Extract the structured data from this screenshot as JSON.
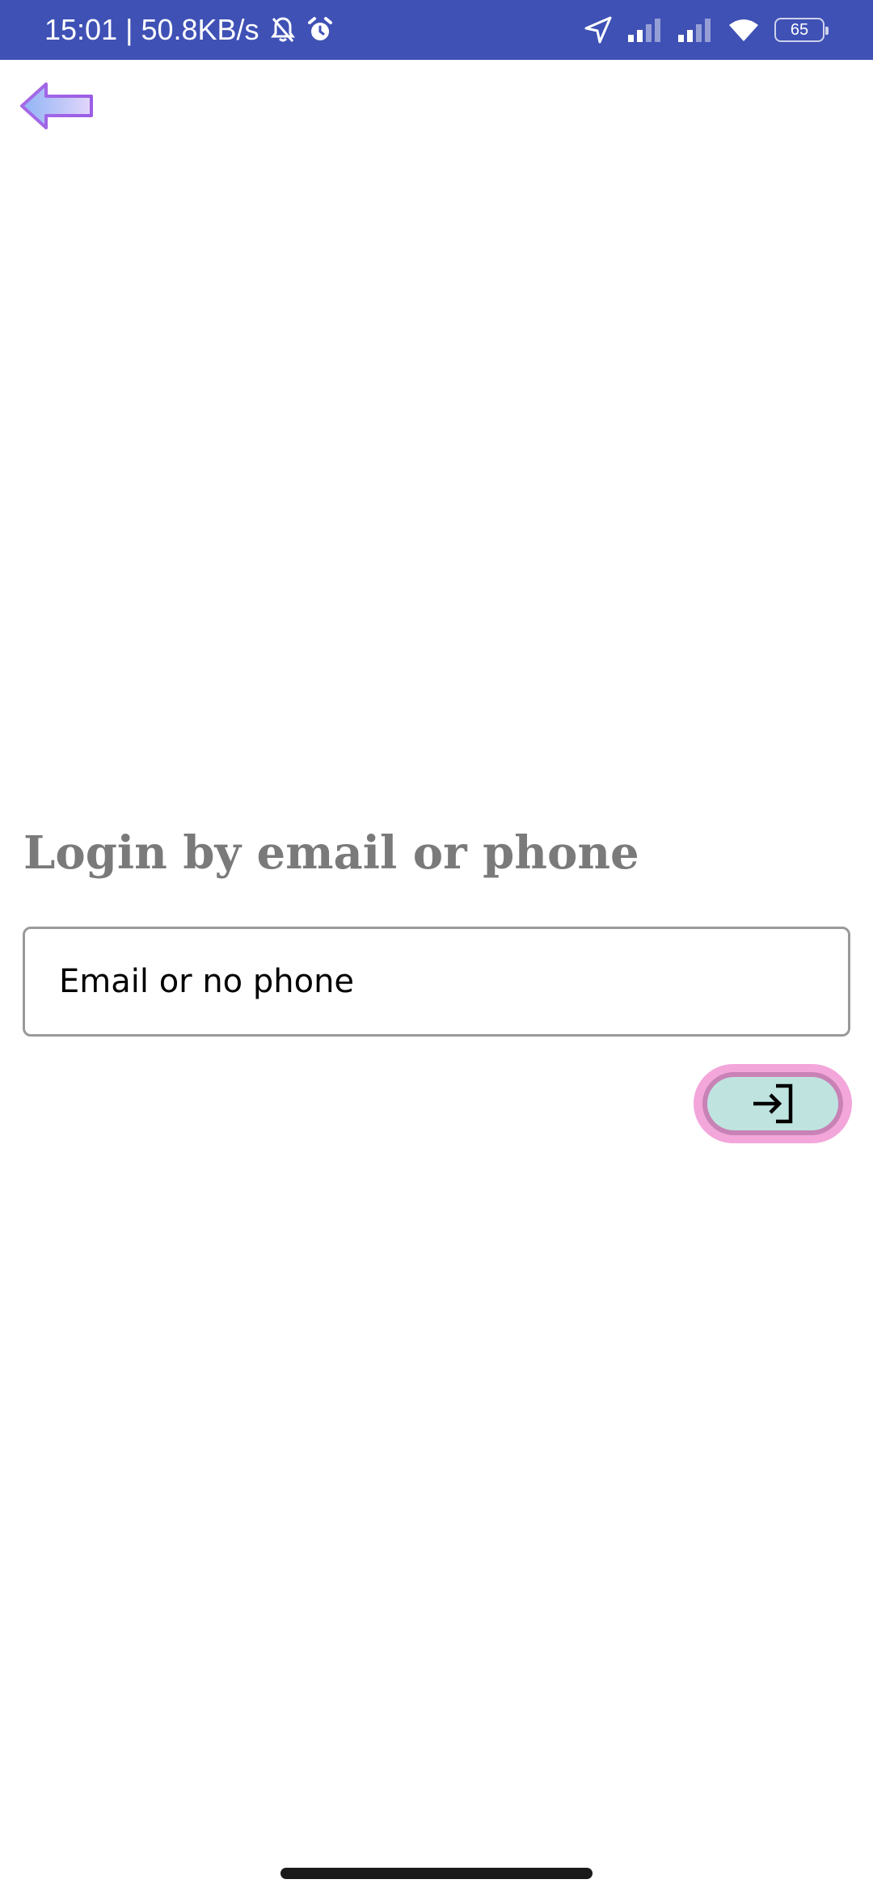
{
  "status_bar": {
    "time_speed": "15:01 | 50.8KB/s",
    "battery_level": "65",
    "background_color": "#3f51b5",
    "icons": [
      "bell-off-icon",
      "alarm-icon",
      "location-arrow-icon",
      "signal-icon",
      "signal-icon",
      "wifi-icon",
      "battery-icon"
    ]
  },
  "header": {
    "back_icon": "arrow-left-icon"
  },
  "login": {
    "title": "Login by email or phone",
    "input_placeholder": "Email or no phone",
    "input_value": "",
    "submit_icon": "login-icon",
    "submit_colors": {
      "outer": "#f3a6da",
      "border": "#c882b6",
      "fill": "#bfe4e0"
    }
  }
}
